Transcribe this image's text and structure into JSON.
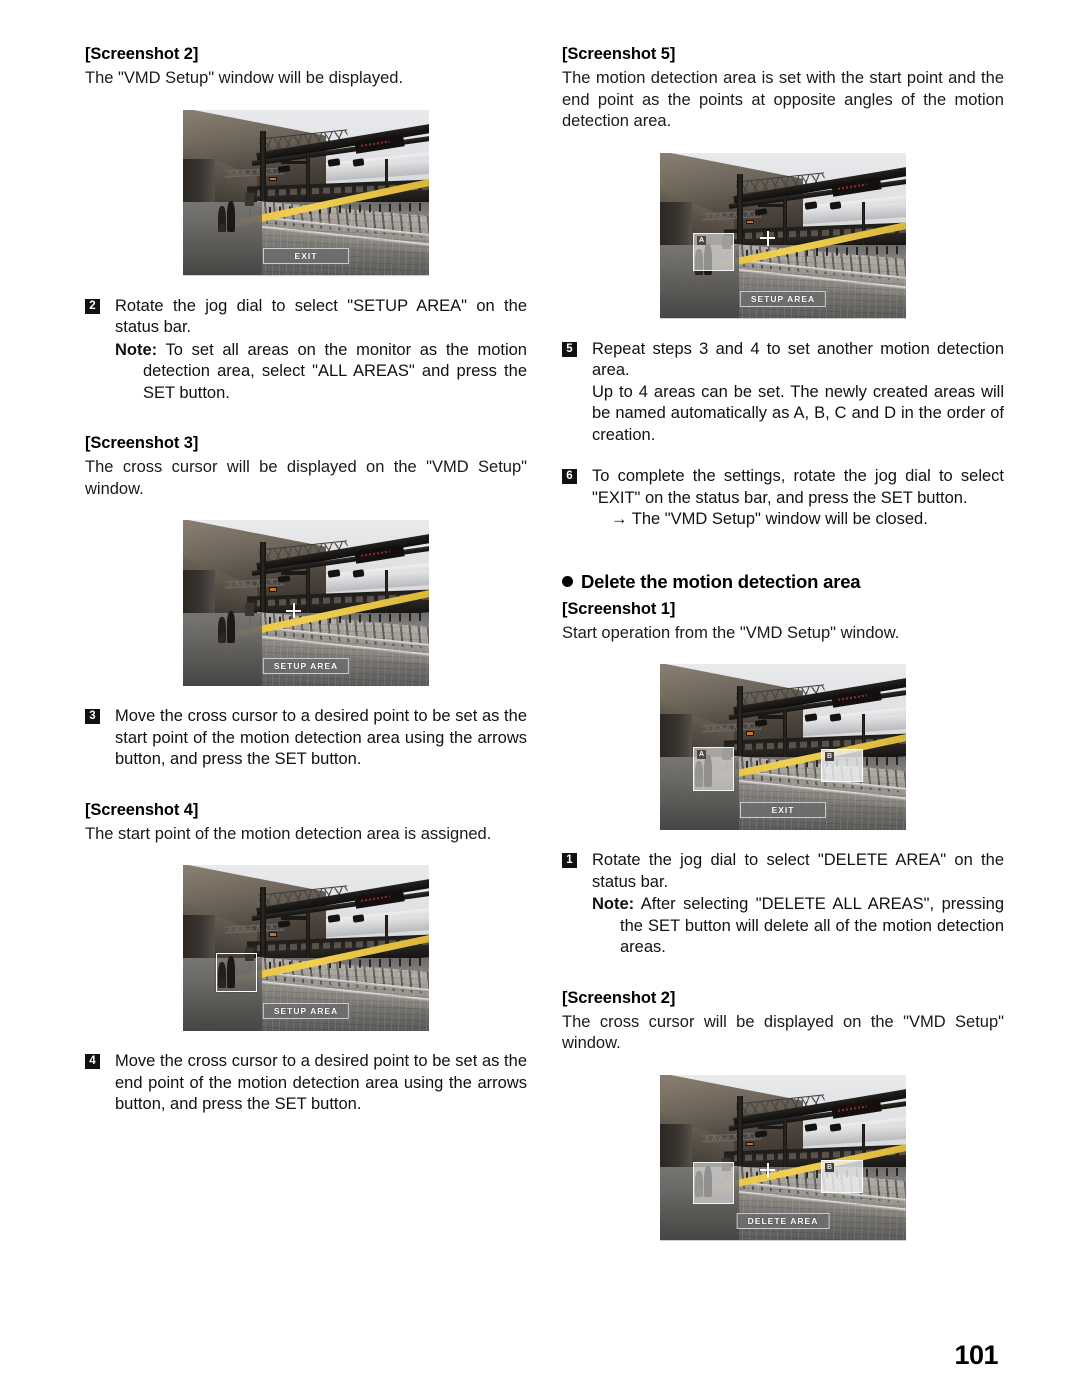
{
  "page": {
    "number": "101"
  },
  "left_column": {
    "shot2": {
      "heading": "[Screenshot 2]",
      "caption": "The \"VMD Setup\" window will be displayed.",
      "image": {
        "alt": "Train station platform VMD Setup window",
        "status_bar": "EXIT",
        "overlays": []
      }
    },
    "step2": {
      "number": "2",
      "text": "Rotate the jog dial to select \"SETUP AREA\" on the status bar.",
      "note_label": "Note:",
      "note_text": "To set all areas on the monitor as the motion detection area, select \"ALL AREAS\" and press the SET button."
    },
    "shot3": {
      "heading": "[Screenshot 3]",
      "caption": "The cross cursor will be displayed on the \"VMD Setup\" window.",
      "image": {
        "alt": "VMD Setup window with cross cursor",
        "status_bar": "SETUP AREA",
        "overlays": [
          "cross-cursor"
        ]
      }
    },
    "step3": {
      "number": "3",
      "text": "Move the cross cursor to a desired point to be set as the start point of the motion detection area using the arrows button, and press the SET button."
    },
    "shot4": {
      "heading": "[Screenshot 4]",
      "caption": "The start point of the motion detection area is assigned.",
      "image": {
        "alt": "VMD Setup window with start point rectangle",
        "status_bar": "SETUP AREA",
        "overlays": [
          "selection-rectangle"
        ]
      }
    },
    "step4": {
      "number": "4",
      "text": "Move the cross cursor to a desired point to be set as the end point of the motion detection area using the arrows button, and press the SET button."
    }
  },
  "right_column": {
    "shot5": {
      "heading": "[Screenshot 5]",
      "caption": "The motion detection area is set with the start point and the end point as the points at opposite angles of the motion detection area.",
      "image": {
        "alt": "VMD Setup window with area A set",
        "status_bar": "SETUP AREA",
        "area_labels": [
          "A"
        ],
        "overlays": [
          "area-a",
          "cross-cursor"
        ]
      }
    },
    "step5": {
      "number": "5",
      "text": "Repeat steps 3 and 4 to set another motion detection area.",
      "text2": "Up to 4 areas can be set. The newly created areas will be named automatically as A, B, C and D in the order of creation."
    },
    "step6": {
      "number": "6",
      "text": "To complete the settings, rotate the jog dial to select \"EXIT\" on the status bar, and press the SET button.",
      "arrow_text": "→  The \"VMD Setup\" window will be closed."
    },
    "section_heading": "Delete the motion detection area",
    "shot1": {
      "heading": "[Screenshot 1]",
      "caption": "Start operation from the \"VMD Setup\" window.",
      "image": {
        "alt": "VMD Setup window with areas A and B",
        "status_bar": "EXIT",
        "area_labels": [
          "A",
          "B"
        ],
        "overlays": [
          "area-a",
          "area-b"
        ]
      }
    },
    "step1": {
      "number": "1",
      "text": "Rotate the jog dial to select \"DELETE AREA\" on the status bar.",
      "note_label": "Note:",
      "note_text": "After selecting \"DELETE ALL AREAS\", pressing the SET button will delete all of the motion detection areas."
    },
    "shot2": {
      "heading": "[Screenshot 2]",
      "caption": "The cross cursor will be displayed on the \"VMD Setup\" window.",
      "image": {
        "alt": "VMD Setup window with cross cursor and DELETE AREA status bar",
        "status_bar": "DELETE AREA",
        "area_labels": [
          "B"
        ],
        "overlays": [
          "area-a",
          "area-b",
          "cross-cursor"
        ]
      }
    }
  }
}
